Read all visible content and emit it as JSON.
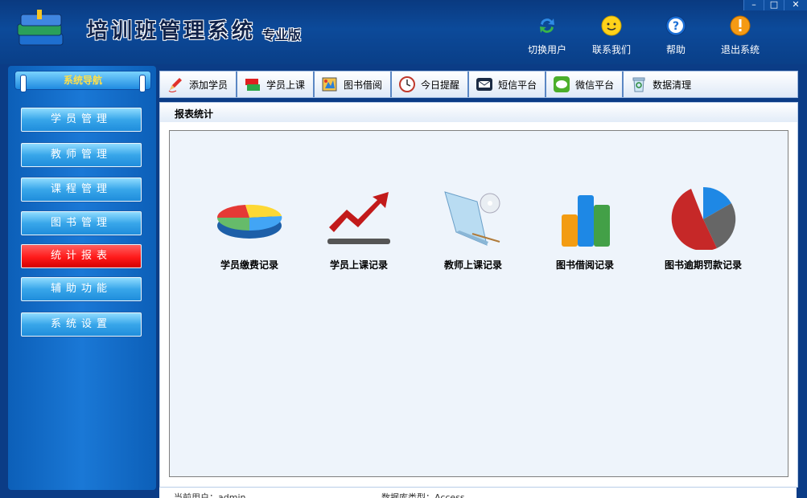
{
  "window": {
    "title_prefix": "培训班管理系统",
    "edition": "专业版",
    "buttons": {
      "minimize": "–",
      "maximize": "□",
      "close": "✕"
    }
  },
  "header_actions": [
    {
      "label": "切换用户",
      "icon": "switch-user-icon"
    },
    {
      "label": "联系我们",
      "icon": "contact-icon"
    },
    {
      "label": "帮助",
      "icon": "help-icon"
    },
    {
      "label": "退出系统",
      "icon": "exit-icon"
    }
  ],
  "sidebar": {
    "header": "系统导航",
    "items": [
      {
        "label": "学员管理"
      },
      {
        "label": "教师管理"
      },
      {
        "label": "课程管理"
      },
      {
        "label": "图书管理"
      },
      {
        "label": "统计报表"
      },
      {
        "label": "辅助功能"
      },
      {
        "label": "系统设置"
      }
    ],
    "active_index": 4
  },
  "toolbar": {
    "items": [
      {
        "label": "添加学员",
        "icon": "pen-icon"
      },
      {
        "label": "学员上课",
        "icon": "flag-icon"
      },
      {
        "label": "图书借阅",
        "icon": "book-icon"
      },
      {
        "label": "今日提醒",
        "icon": "clock-icon"
      },
      {
        "label": "短信平台",
        "icon": "sms-icon"
      },
      {
        "label": "微信平台",
        "icon": "wechat-icon"
      },
      {
        "label": "数据清理",
        "icon": "recycle-icon"
      }
    ]
  },
  "panel": {
    "title": "报表统计",
    "items": [
      {
        "label": "学员缴费记录",
        "icon": "pie-chart-icon"
      },
      {
        "label": "学员上课记录",
        "icon": "trend-up-icon"
      },
      {
        "label": "教师上课记录",
        "icon": "teacher-screen-icon"
      },
      {
        "label": "图书借阅记录",
        "icon": "bar-chart-icon"
      },
      {
        "label": "图书逾期罚款记录",
        "icon": "pie-chart-2-icon"
      }
    ]
  },
  "statusbar": {
    "user": "当前用户：admin",
    "db": "数据库类型：Access"
  },
  "colors": {
    "active_nav": "#ff1a1a",
    "nav_button": "#38a6ea",
    "window_bg": "#0b3c86"
  }
}
